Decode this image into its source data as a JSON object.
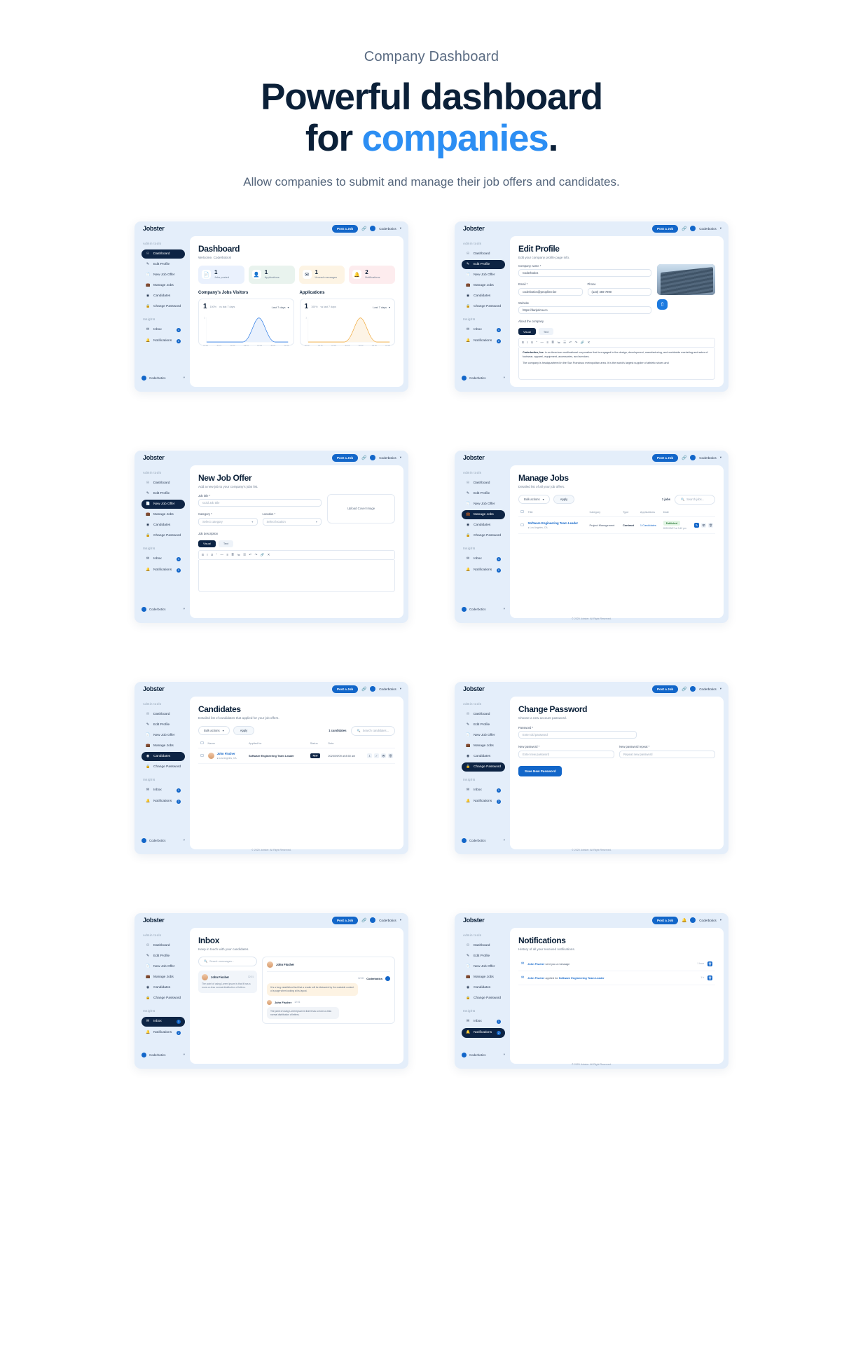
{
  "hero": {
    "eyebrow": "Company Dashboard",
    "title_line1": "Powerful dashboard",
    "title_line2_prefix": "for ",
    "title_line2_accent": "companies",
    "title_period": ".",
    "subtitle": "Allow companies to submit and manage their job offers and candidates."
  },
  "colors": {
    "accent": "#2c8ef3",
    "primary": "#1266c9",
    "dark": "#0d2444",
    "screen_bg": "#e4eefa"
  },
  "common": {
    "brand": "Jobster",
    "post_job": "Post a Job",
    "user_name": "Coderbotics",
    "caret": "▾",
    "sidebar_label_admin": "Admin tools",
    "sidebar_label_insights": "Insights",
    "nav": [
      {
        "label": "Dashboard",
        "icon": "home-icon"
      },
      {
        "label": "Edit Profile",
        "icon": "pencil-icon"
      },
      {
        "label": "New Job Offer",
        "icon": "document-icon"
      },
      {
        "label": "Manage Jobs",
        "icon": "briefcase-icon"
      },
      {
        "label": "Candidates",
        "icon": "user-circle-icon"
      },
      {
        "label": "Change Password",
        "icon": "lock-icon"
      }
    ],
    "insights": [
      {
        "label": "Inbox",
        "icon": "envelope-icon",
        "badge": "1"
      },
      {
        "label": "Notifications",
        "icon": "bell-icon",
        "badge": "2"
      }
    ],
    "footer_copyright": "© 2020 Jobster. All Right Reserved."
  },
  "screen_dashboard": {
    "title": "Dashboard",
    "subtitle": "Welcome, Coderbotics!",
    "stats": [
      {
        "value": "1",
        "label": "Jobs posted",
        "icon": "file-icon",
        "theme": "s-blue"
      },
      {
        "value": "1",
        "label": "Applications",
        "icon": "person-icon",
        "theme": "s-green"
      },
      {
        "value": "1",
        "label": "Unread messages",
        "icon": "mail-icon",
        "theme": "s-amber"
      },
      {
        "value": "2",
        "label": "Notifications",
        "icon": "bell-icon",
        "theme": "s-rose"
      }
    ],
    "charts": [
      {
        "heading": "Company's Jobs Visitors",
        "big_value": "1",
        "delta": "100%",
        "compare": "vs last 7 days",
        "range": "Last 7 days"
      },
      {
        "heading": "Applications",
        "big_value": "1",
        "delta": "100%",
        "compare": "vs last 7 days",
        "range": "Last 7 days"
      }
    ],
    "chart_data": [
      {
        "type": "area",
        "title": "Company's Jobs Visitors",
        "xlabel": "",
        "ylabel": "",
        "ylim": [
          0,
          1
        ],
        "x": [
          "Jul 20",
          "Jul 21",
          "Jul 22",
          "Jul 23",
          "Jul 24",
          "Jul 25",
          "Jul 26"
        ],
        "y": [
          0,
          0,
          0,
          0,
          1,
          0,
          0
        ],
        "ytick_labels": [
          "1"
        ],
        "line_color": "#2c7be5",
        "fill_color": "#e8f1fd",
        "grid": false,
        "legend": "none"
      },
      {
        "type": "area",
        "title": "Applications",
        "xlabel": "",
        "ylabel": "",
        "ylim": [
          0,
          1
        ],
        "x": [
          "Jul 20",
          "Jul 21",
          "Jul 22",
          "Jul 23",
          "Jul 24",
          "Jul 25",
          "Jul 26"
        ],
        "y": [
          0,
          0,
          0,
          0,
          1,
          0,
          0
        ],
        "ytick_labels": [
          "1"
        ],
        "line_color": "#f0a93b",
        "fill_color": "#fdf4e6",
        "grid": false,
        "legend": "none"
      }
    ]
  },
  "screen_edit_profile": {
    "title": "Edit Profile",
    "subtitle": "Edit your company profile page info.",
    "f_company_label": "Company name *",
    "f_company_value": "Coderbotics",
    "f_email_label": "Email *",
    "f_email_value": "coderbotics@peoplime.be",
    "f_phone_label": "Phone",
    "f_phone_value": "(123) 456-7890",
    "f_website_label": "Website",
    "f_website_value": "https://dariprima.co",
    "about_label": "About the company",
    "tab_visual": "Visual",
    "tab_text": "Text",
    "toolbar": "B  I  U  “  —  ≡  ≣  ≔  ☰  ↶  ↷  🔗  ✕",
    "body_lead": "Coderbotics, Inc.",
    "body_p1": " is an American multinational corporation that is engaged in the design, development, manufacturing, and worldwide marketing and sales of footwear, apparel, equipment, accessories, and services.",
    "body_p2": "The company is headquartered in the San Francisco metropolitan area. It is the world's largest supplier of athletic shoes and",
    "upload_icon": "upload-icon"
  },
  "screen_new_job": {
    "title": "New Job Offer",
    "subtitle": "Add a new job to your company's jobs list.",
    "f_title_label": "Job title *",
    "f_title_ph": "Gold Job title",
    "f_category_label": "Category *",
    "f_category_value": "Select category",
    "f_location_label": "Location *",
    "f_location_value": "Select location",
    "upload_label": "Upload Cover Image",
    "desc_label": "Job description",
    "tab_visual": "Visual",
    "tab_text": "Text",
    "toolbar": "B  I  U  “  —  ≡  ≣  ≔  ☰  ↶  ↷  🔗  ✕"
  },
  "screen_manage_jobs": {
    "title": "Manage Jobs",
    "subtitle": "Detailed list of all your job offers.",
    "bulk_label": "Bulk actions",
    "apply_label": "Apply",
    "count": "1 jobs",
    "search_ph": "Search jobs...",
    "columns": [
      "",
      "Title",
      "Category",
      "Type",
      "Applications",
      "Date"
    ],
    "rows": [
      {
        "title": "Software Engineering Team Leader",
        "location": "Los Angeles, CA",
        "category": "Project Management",
        "type": "Contract",
        "applications": "1 Candidates",
        "status": "Published",
        "date": "2020/09/07 at 3:42 pm"
      }
    ]
  },
  "screen_candidates": {
    "title": "Candidates",
    "subtitle": "Detailed list of candidates that applied for your job offers.",
    "bulk_label": "Bulk actions",
    "apply_label": "Apply",
    "count": "1 candidates",
    "search_ph": "Search candidates...",
    "columns": [
      "",
      "Name",
      "Applied for",
      "Status",
      "Date"
    ],
    "rows": [
      {
        "name": "John Fischer",
        "location": "Los Angeles, CA",
        "applied_for": "Software Engineering Team Leader",
        "status": "New",
        "date": "2020/09/09 at 8:50 am"
      }
    ]
  },
  "screen_change_password": {
    "title": "Change Password",
    "subtitle": "Choose a new account password.",
    "f_current_label": "Password *",
    "f_current_ph": "Enter old password",
    "f_new_label": "New password *",
    "f_new_ph": "Enter new password",
    "f_repeat_label": "New password repeat *",
    "f_repeat_ph": "Repeat new password",
    "save_label": "Save New Password"
  },
  "screen_inbox": {
    "title": "Inbox",
    "subtitle": "Keep in touch with your candidates.",
    "search_ph": "Search messages...",
    "conversations": [
      {
        "name": "John Fischer",
        "time": "12:01",
        "preview": "The point of using Lorem Ipsum is that it has a more-or-less normal distribution of letters."
      }
    ],
    "thread_name": "John Fischer",
    "messages": [
      {
        "side": "right",
        "author": "Coderbotics",
        "time": "12:00",
        "text": "It is a long established fact that a reader will be distracted by the readable content of a page when looking at its layout."
      },
      {
        "side": "left",
        "author": "John Fischer",
        "time": "12:01",
        "text": "The point of using Lorem Ipsum is that it has a more-or-less normal distribution of letters."
      }
    ]
  },
  "screen_notifications": {
    "title": "Notifications",
    "subtitle": "History of all your received notifications.",
    "items": [
      {
        "prefix": "John Fischer",
        "text": " sent you a message",
        "link": "",
        "time": "1 hour",
        "icon": "envelope-icon"
      },
      {
        "prefix": "John Fischer",
        "text": " applied for ",
        "link": "Software Engineering Team Leader",
        "time": "1 h",
        "icon": "envelope-icon"
      }
    ]
  }
}
